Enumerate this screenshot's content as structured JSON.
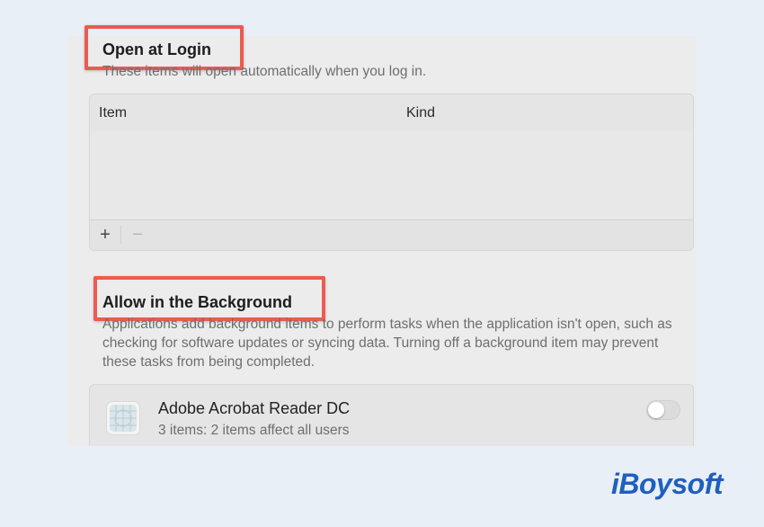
{
  "login_section": {
    "title": "Open at Login",
    "description": "These items will open automatically when you log in."
  },
  "login_table": {
    "columns": [
      "Item",
      "Kind"
    ],
    "add_label": "+",
    "remove_label": "−"
  },
  "background_section": {
    "title": "Allow in the Background",
    "description": "Applications add background items to perform tasks when the application isn't open, such as checking for software updates or syncing data. Turning off a background item may prevent these tasks from being completed."
  },
  "background_items": [
    {
      "name": "Adobe Acrobat Reader DC",
      "detail": "3 items: 2 items affect all users",
      "enabled": false,
      "icon": "acrobat-reader-icon"
    }
  ],
  "watermark": {
    "text": "iBoysoft",
    "color": "#1f5fbf"
  },
  "colors": {
    "highlight": "#ec5b50",
    "page_background": "#e9eff6",
    "panel_background": "#ececec"
  }
}
